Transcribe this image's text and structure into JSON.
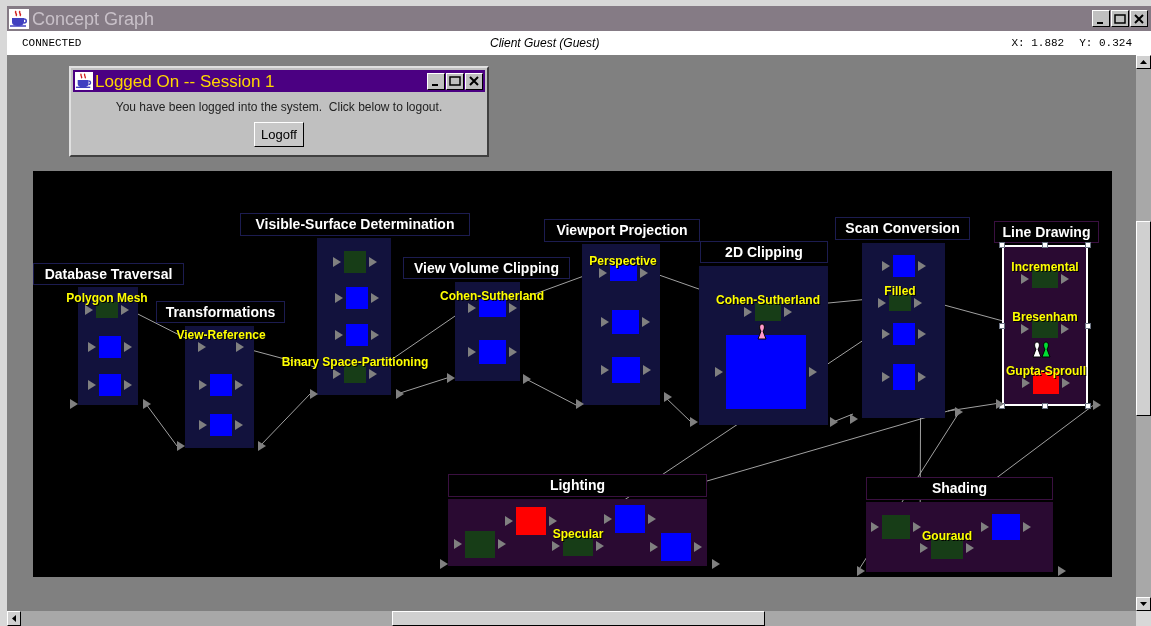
{
  "window": {
    "title": "Concept Graph"
  },
  "status_bar": {
    "connection": "CONNECTED",
    "user": "Client Guest (Guest)",
    "x_reading": "X: 1.882",
    "y_reading": "Y: 0.324"
  },
  "dialog": {
    "title": "Logged On -- Session 1",
    "message": "You have been logged into the system.  Click below to logout.",
    "button": "Logoff"
  },
  "graph": {
    "groups": [
      {
        "title": "Database Traversal",
        "color": "#12123d",
        "selected": false,
        "nodes": [
          {
            "label": "Polygon Mesh",
            "color": "#173d17"
          },
          {
            "color": "#0000ff"
          },
          {
            "color": "#0000ff"
          }
        ]
      },
      {
        "title": "Transformations",
        "color": "#12123d",
        "selected": false,
        "nodes": [
          {
            "label": "View-Reference"
          },
          {
            "color": "#0000ff"
          },
          {
            "color": "#0000ff"
          }
        ]
      },
      {
        "title": "Visible-Surface Determination",
        "color": "#12123d",
        "selected": false,
        "nodes": [
          {
            "color": "#173d17"
          },
          {
            "color": "#0000ff"
          },
          {
            "color": "#0000ff"
          },
          {
            "label": "Binary Space-Partitioning",
            "color": "#173d17"
          }
        ]
      },
      {
        "title": "View Volume Clipping",
        "color": "#12123d",
        "selected": false,
        "nodes": [
          {
            "label": "Cohen-Sutherland",
            "color": "#0000ff"
          },
          {
            "color": "#0000ff"
          }
        ]
      },
      {
        "title": "Viewport Projection",
        "color": "#12123d",
        "selected": false,
        "nodes": [
          {
            "label": "Perspective",
            "color": "#0000ff"
          },
          {
            "color": "#0000ff"
          },
          {
            "color": "#0000ff"
          }
        ]
      },
      {
        "title": "2D Clipping",
        "color": "#12123d",
        "selected": false,
        "nodes": [
          {
            "label": "Cohen-Sutherland",
            "color": "#173d17"
          },
          {
            "color": "#0000ff"
          }
        ],
        "markers": [
          {
            "color": "#ff99cc"
          }
        ]
      },
      {
        "title": "Scan Conversion",
        "color": "#12123d",
        "selected": false,
        "nodes": [
          {
            "color": "#0000ff"
          },
          {
            "label": "Filled",
            "color": "#173d17"
          },
          {
            "color": "#0000ff"
          },
          {
            "color": "#0000ff"
          }
        ]
      },
      {
        "title": "Line Drawing",
        "color": "#2a0a32",
        "selected": true,
        "nodes": [
          {
            "label": "Incremental",
            "color": "#173d17"
          },
          {
            "label": "Bresenham",
            "color": "#173d17"
          },
          {
            "label": "Gupta-Sproull",
            "color": "#ff0000"
          }
        ],
        "markers": [
          {
            "color": "#ffffff"
          },
          {
            "color": "#00dd33"
          }
        ]
      },
      {
        "title": "Lighting",
        "color": "#2a0a32",
        "selected": false,
        "nodes": [
          {
            "color": "#173d17"
          },
          {
            "color": "#ff0000"
          },
          {
            "label": "Specular",
            "color": "#173d17"
          },
          {
            "color": "#0000ff"
          },
          {
            "color": "#0000ff"
          }
        ]
      },
      {
        "title": "Shading",
        "color": "#2a0a32",
        "selected": false,
        "nodes": [
          {
            "color": "#173d17"
          },
          {
            "label": "Gouraud",
            "color": "#173d17"
          },
          {
            "color": "#0000ff"
          }
        ]
      }
    ]
  }
}
